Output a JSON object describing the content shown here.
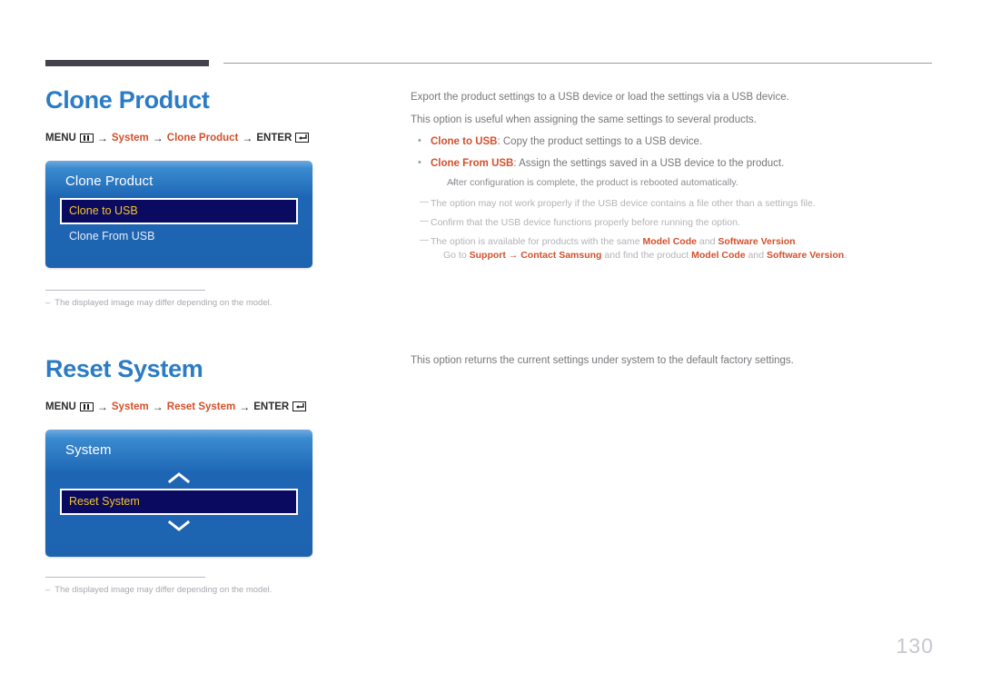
{
  "document": {
    "page_number": "130"
  },
  "colors": {
    "heading_blue": "#2b7cc4",
    "accent_red": "#d2512c",
    "osd_blue": "#1e66b4",
    "osd_selected_bg": "#0a0a60",
    "osd_selected_text": "#f2c62b",
    "body_gray": "#77777c"
  },
  "sections": [
    {
      "title": "Clone Product",
      "menu_path": {
        "menu_label": "MENU",
        "menu_icon": "menu-bars-icon",
        "arrow": "→",
        "steps": [
          "System",
          "Clone Product"
        ],
        "enter_label": "ENTER",
        "enter_icon": "enter-return-icon"
      },
      "osd": {
        "title": "Clone Product",
        "items": [
          {
            "label": "Clone to USB",
            "selected": true
          },
          {
            "label": "Clone From USB",
            "selected": false
          }
        ],
        "chevron_up": false,
        "chevron_down": false
      },
      "footnote": {
        "dash": "–",
        "text": "The displayed image may differ depending on the model."
      },
      "right": {
        "paragraphs": [
          "Export the product settings to a USB device or load the settings via a USB device.",
          "This option is useful when assigning the same settings to several products."
        ],
        "bullets": [
          {
            "label": "Clone to USB",
            "text": ": Copy the product settings to a USB device."
          },
          {
            "label": "Clone From USB",
            "text": ": Assign the settings saved in a USB device to the product."
          }
        ],
        "subnotes": [
          "After configuration is complete, the product is rebooted automatically."
        ],
        "notes": [
          {
            "segments": [
              {
                "text": "The option may not work properly if the USB device contains a file other than a settings file.",
                "bold": false
              }
            ]
          },
          {
            "segments": [
              {
                "text": "Confirm that the USB device functions properly before running the option.",
                "bold": false
              }
            ]
          },
          {
            "segments": [
              {
                "text": "The option is available for products with the same ",
                "bold": false
              },
              {
                "text": "Model Code",
                "bold": true
              },
              {
                "text": " and ",
                "bold": false
              },
              {
                "text": "Software Version",
                "bold": true
              },
              {
                "text": ".",
                "bold": false
              }
            ],
            "second_line": [
              {
                "text": "Go to ",
                "bold": false
              },
              {
                "text": "Support",
                "bold": true
              },
              {
                "text": " → ",
                "bold": true
              },
              {
                "text": "Contact Samsung",
                "bold": true
              },
              {
                "text": " and find the product ",
                "bold": false
              },
              {
                "text": "Model Code",
                "bold": true
              },
              {
                "text": " and ",
                "bold": false
              },
              {
                "text": "Software Version",
                "bold": true
              },
              {
                "text": ".",
                "bold": false
              }
            ]
          }
        ]
      }
    },
    {
      "title": "Reset System",
      "menu_path": {
        "menu_label": "MENU",
        "menu_icon": "menu-bars-icon",
        "arrow": "→",
        "steps": [
          "System",
          "Reset System"
        ],
        "enter_label": "ENTER",
        "enter_icon": "enter-return-icon"
      },
      "osd": {
        "title": "System",
        "items": [
          {
            "label": "Reset System",
            "selected": true
          }
        ],
        "chevron_up": true,
        "chevron_down": true
      },
      "footnote": {
        "dash": "–",
        "text": "The displayed image may differ depending on the model."
      },
      "right": {
        "paragraphs": [
          "This option returns the current settings under system to the default factory settings."
        ],
        "bullets": [],
        "subnotes": [],
        "notes": []
      }
    }
  ]
}
